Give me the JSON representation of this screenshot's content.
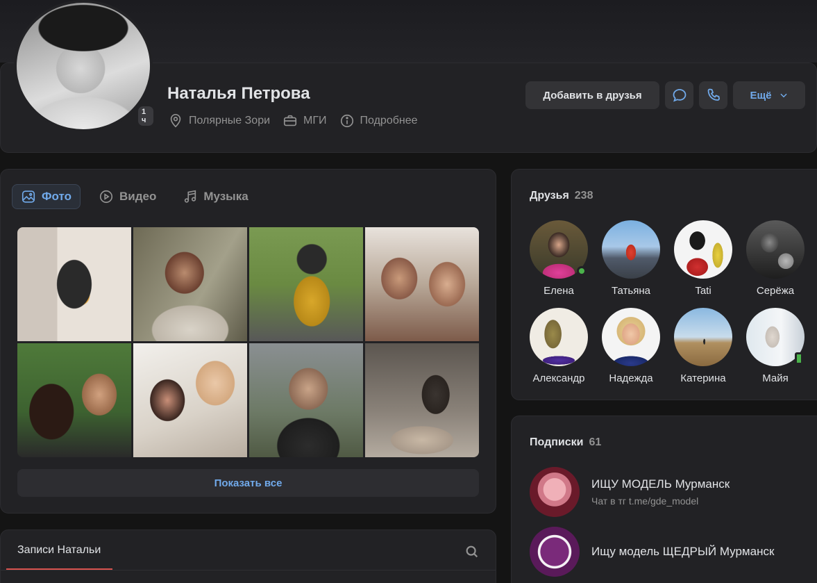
{
  "profile": {
    "name": "Наталья Петрова",
    "online_badge": "1 ч",
    "city": "Полярные Зори",
    "education": "МГИ",
    "details_link": "Подробнее",
    "add_friend_label": "Добавить в друзья",
    "more_label": "Ещё"
  },
  "media": {
    "tabs": [
      {
        "label": "Фото",
        "active": true
      },
      {
        "label": "Видео",
        "active": false
      },
      {
        "label": "Музыка",
        "active": false
      }
    ],
    "show_all_label": "Показать все"
  },
  "posts": {
    "tab_label": "Записи Натальи"
  },
  "friends": {
    "title": "Друзья",
    "count": "238",
    "items": [
      {
        "name": "Елена",
        "online": "dot"
      },
      {
        "name": "Татьяна",
        "online": "none"
      },
      {
        "name": "Tati",
        "online": "none"
      },
      {
        "name": "Серёжа",
        "online": "none"
      },
      {
        "name": "Александр",
        "online": "none"
      },
      {
        "name": "Надежда",
        "online": "none"
      },
      {
        "name": "Катерина",
        "online": "none"
      },
      {
        "name": "Майя",
        "online": "mobile"
      }
    ]
  },
  "subscriptions": {
    "title": "Подписки",
    "count": "61",
    "items": [
      {
        "title": "ИЩУ МОДЕЛЬ Мурманск",
        "desc": "Чат в тг t.me/gde_model"
      },
      {
        "title": "Ищу модель ЩЕДРЫЙ Мурманск",
        "desc": ""
      }
    ]
  },
  "colors": {
    "accent": "#71aaeb",
    "online": "#4bb34b",
    "tab_underline": "#d9534f"
  }
}
